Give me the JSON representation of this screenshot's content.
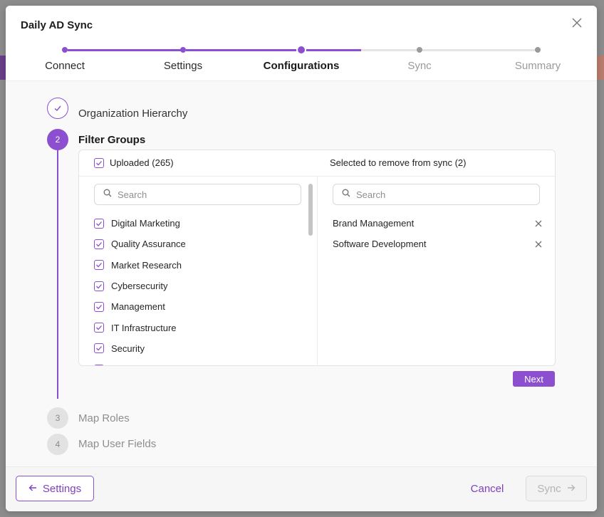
{
  "dialog": {
    "title": "Daily AD Sync"
  },
  "stepper": {
    "steps": [
      {
        "label": "Connect",
        "state": "done"
      },
      {
        "label": "Settings",
        "state": "done"
      },
      {
        "label": "Configurations",
        "state": "current"
      },
      {
        "label": "Sync",
        "state": "todo"
      },
      {
        "label": "Summary",
        "state": "todo"
      }
    ]
  },
  "sections": [
    {
      "number": "",
      "label": "Organization Hierarchy",
      "state": "done"
    },
    {
      "number": "2",
      "label": "Filter Groups",
      "state": "active"
    },
    {
      "number": "3",
      "label": "Map Roles",
      "state": "todo"
    },
    {
      "number": "4",
      "label": "Map User Fields",
      "state": "todo"
    }
  ],
  "filter_groups": {
    "uploaded_label": "Uploaded (265)",
    "selected_label": "Selected to remove from sync (2)",
    "left_search_placeholder": "Search",
    "right_search_placeholder": "Search",
    "uploaded_items": [
      "Digital Marketing",
      "Quality Assurance",
      "Market Research",
      "Cybersecurity",
      "Management",
      "IT Infrastructure",
      "Security"
    ],
    "selected_items": [
      "Brand Management",
      "Software Development"
    ],
    "next_label": "Next"
  },
  "footer": {
    "back_label": "Settings",
    "cancel_label": "Cancel",
    "sync_label": "Sync"
  },
  "colors": {
    "accent": "#8b4fcf",
    "disabled": "#b5b5b5"
  }
}
